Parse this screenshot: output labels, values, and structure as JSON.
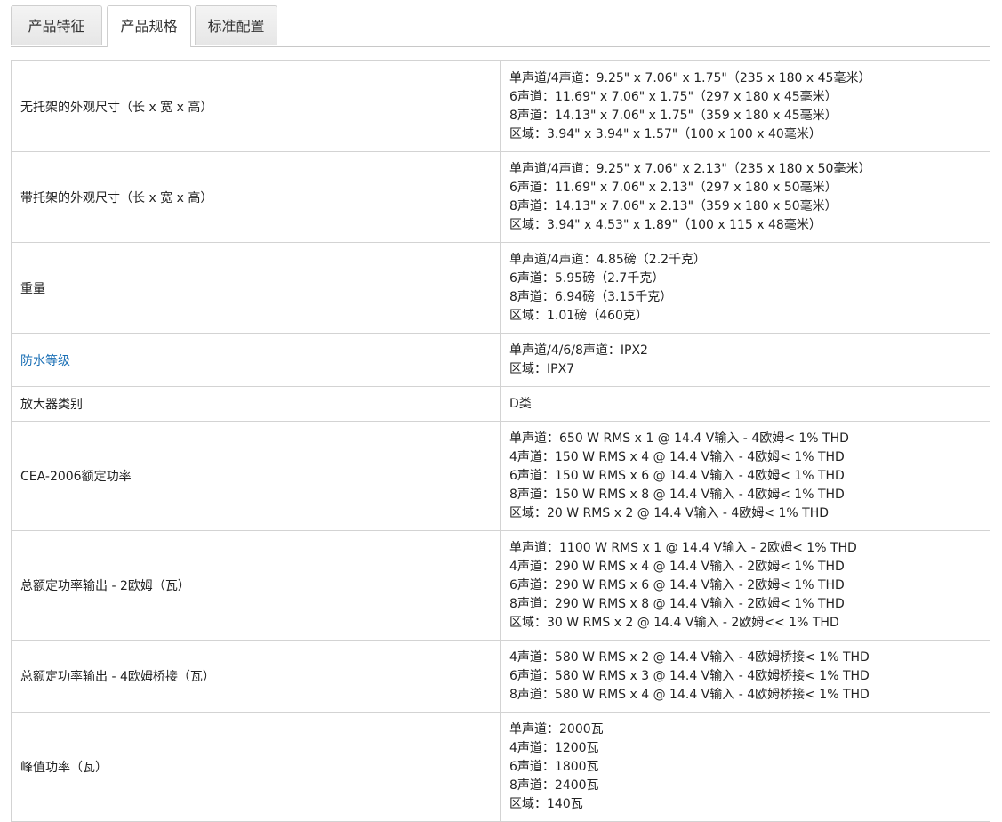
{
  "tabs": [
    {
      "label": "产品特征",
      "active": false
    },
    {
      "label": "产品规格",
      "active": true
    },
    {
      "label": "标准配置",
      "active": false
    }
  ],
  "link_color": "#1a6fb5",
  "rows": [
    {
      "label": "无托架的外观尺寸（长 x 宽 x 高）",
      "values": [
        "单声道/4声道：9.25\" x 7.06\" x 1.75\"（235 x 180 x 45毫米）",
        "6声道：11.69\" x 7.06\" x 1.75\"（297 x 180 x 45毫米）",
        "8声道：14.13\" x 7.06\" x 1.75\"（359 x 180 x 45毫米）",
        "区域：3.94\" x 3.94\" x 1.57\"（100 x 100 x 40毫米）"
      ]
    },
    {
      "label": "带托架的外观尺寸（长 x 宽 x 高）",
      "values": [
        "单声道/4声道：9.25\" x 7.06\" x 2.13\"（235 x 180 x 50毫米）",
        "6声道：11.69\" x 7.06\" x 2.13\"（297 x 180 x 50毫米）",
        "8声道：14.13\" x 7.06\" x 2.13\"（359 x 180 x 50毫米）",
        "区域：3.94\" x 4.53\" x 1.89\"（100 x 115 x 48毫米）"
      ]
    },
    {
      "label": "重量",
      "values": [
        "单声道/4声道：4.85磅（2.2千克）",
        "6声道：5.95磅（2.7千克）",
        "8声道：6.94磅（3.15千克）",
        "区域：1.01磅（460克）"
      ]
    },
    {
      "label": "防水等级",
      "is_link": true,
      "values": [
        "单声道/4/6/8声道：IPX2",
        "区域：IPX7"
      ]
    },
    {
      "label": "放大器类别",
      "values": [
        "D类"
      ]
    },
    {
      "label": "CEA-2006额定功率",
      "values": [
        "单声道：650 W RMS x 1 @ 14.4 V输入 - 4欧姆< 1% THD",
        "4声道：150 W RMS x 4 @ 14.4 V输入 - 4欧姆< 1% THD",
        "6声道：150 W RMS x 6 @ 14.4 V输入 - 4欧姆< 1% THD",
        "8声道：150 W RMS x 8 @ 14.4 V输入 - 4欧姆< 1% THD",
        "区域：20 W RMS x 2 @ 14.4 V输入 - 4欧姆< 1% THD"
      ]
    },
    {
      "label": "总额定功率输出 - 2欧姆（瓦）",
      "values": [
        "单声道：1100 W RMS x 1 @ 14.4 V输入 - 2欧姆< 1% THD",
        "4声道：290 W RMS x 4 @ 14.4 V输入 - 2欧姆< 1% THD",
        "6声道：290 W RMS x 6 @ 14.4 V输入 - 2欧姆< 1% THD",
        "8声道：290 W RMS x 8 @ 14.4 V输入 - 2欧姆< 1% THD",
        "区域：30 W RMS x 2 @ 14.4 V输入 - 2欧姆<< 1% THD"
      ]
    },
    {
      "label": "总额定功率输出 - 4欧姆桥接（瓦）",
      "values": [
        "4声道：580 W RMS x 2 @ 14.4 V输入 - 4欧姆桥接< 1% THD",
        "6声道：580 W RMS x 3 @ 14.4 V输入 - 4欧姆桥接< 1% THD",
        "8声道：580 W RMS x 4 @ 14.4 V输入 - 4欧姆桥接< 1% THD"
      ]
    },
    {
      "label": "峰值功率（瓦）",
      "values": [
        "单声道：2000瓦",
        "4声道：1200瓦",
        "6声道：1800瓦",
        "8声道：2400瓦",
        "区域：140瓦"
      ]
    }
  ]
}
